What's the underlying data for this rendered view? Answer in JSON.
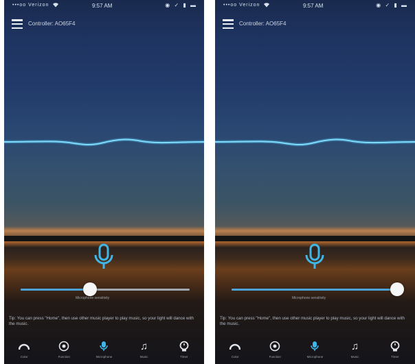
{
  "colors": {
    "accent": "#3fb6e8",
    "wave": "#4ec3ee",
    "thumb": "#f6f6f6"
  },
  "screens": [
    {
      "status": {
        "signal": "•••oo Verizon",
        "time": "9:57 AM",
        "right_icons": "◉ ✓ ▮ ▬"
      },
      "header": {
        "menu_icon": "hamburger-icon",
        "title": "Controller: AO65F4"
      },
      "mic_icon": "microphone-icon",
      "sensitivity": {
        "value": 0.41,
        "label": "Microphone sensitivity"
      },
      "tip": "Tip: You can press \"Home\", then use other music player to play music, so your light will dance with the music.",
      "tabs": [
        {
          "label": "Color",
          "icon": "color-wheel-icon",
          "active": false
        },
        {
          "label": "Function",
          "icon": "function-icon",
          "active": false
        },
        {
          "label": "Microphone",
          "icon": "microphone-icon",
          "active": true
        },
        {
          "label": "Music",
          "icon": "music-note-icon",
          "active": false
        },
        {
          "label": "Timer",
          "icon": "timer-icon",
          "active": false
        }
      ]
    },
    {
      "status": {
        "signal": "•••oo Verizon",
        "time": "9:57 AM",
        "right_icons": "◉ ✓ ▮ ▬"
      },
      "header": {
        "menu_icon": "hamburger-icon",
        "title": "Controller: AO65F4"
      },
      "mic_icon": "microphone-icon",
      "sensitivity": {
        "value": 0.98,
        "label": "Microphone sensitivity"
      },
      "tip": "Tip: You can press \"Home\", then use other music player to play music, so your light will dance with the music.",
      "tabs": [
        {
          "label": "Color",
          "icon": "color-wheel-icon",
          "active": false
        },
        {
          "label": "Function",
          "icon": "function-icon",
          "active": false
        },
        {
          "label": "Microphone",
          "icon": "microphone-icon",
          "active": true
        },
        {
          "label": "Music",
          "icon": "music-note-icon",
          "active": false
        },
        {
          "label": "Timer",
          "icon": "timer-icon",
          "active": false
        }
      ]
    }
  ]
}
